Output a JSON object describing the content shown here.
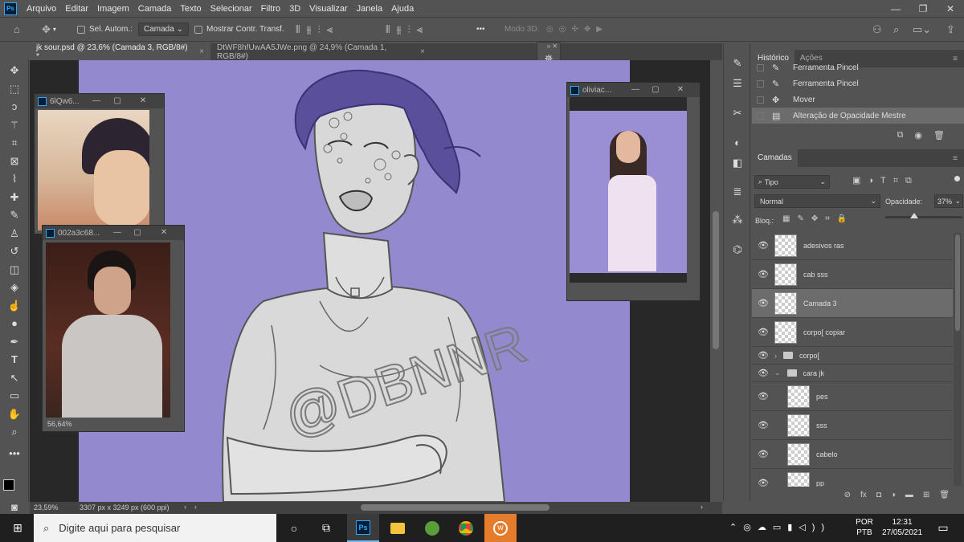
{
  "menu": {
    "logo": "Ps",
    "items": [
      "Arquivo",
      "Editar",
      "Imagem",
      "Camada",
      "Texto",
      "Selecionar",
      "Filtro",
      "3D",
      "Visualizar",
      "Janela",
      "Ajuda"
    ]
  },
  "options": {
    "auto_select_label": "Sel. Autom.:",
    "auto_select_target": "Camada",
    "show_transform_label": "Mostrar Contr. Transf.",
    "mode3d_label": "Modo 3D:",
    "more": "•••"
  },
  "tabs": [
    {
      "label": "jk sour.psd @ 23,6% (Camada 3, RGB/8#) *",
      "close": "×"
    },
    {
      "label": "DtWF8hfUwAA5JWe.png @ 24,9% (Camada 1, RGB/8#)",
      "close": "×"
    }
  ],
  "float_windows": {
    "win1": {
      "title": "6lQw6..."
    },
    "win2": {
      "title": "002a3c68...",
      "zoom": "56,64%"
    },
    "win3": {
      "title": "oliviac..."
    }
  },
  "artwork": {
    "watermark": "@DBNNR"
  },
  "status": {
    "zoom": "23,59%",
    "size": "3307 px x 3249 px (600 ppi)"
  },
  "history": {
    "tabs": [
      "Histórico",
      "Ações"
    ],
    "items": [
      {
        "label": "Ferramenta Pincel",
        "icon": "brush-icon"
      },
      {
        "label": "Ferramenta Pincel",
        "icon": "brush-icon"
      },
      {
        "label": "Mover",
        "icon": "move-icon"
      },
      {
        "label": "Alteração de Opacidade Mestre",
        "icon": "document-icon"
      }
    ]
  },
  "layers_panel": {
    "title": "Camadas",
    "filter": "Tipo",
    "blend_mode": "Normal",
    "opacity_label": "Opacidade:",
    "opacity_value": "37%",
    "opacity_fraction": 0.37,
    "lock_label": "Bloq.:",
    "layers": [
      {
        "name": "adesivos ras",
        "type": "layer",
        "indent": 0
      },
      {
        "name": "cab sss",
        "type": "layer",
        "indent": 0
      },
      {
        "name": "Camada 3",
        "type": "layer",
        "indent": 0,
        "selected": true
      },
      {
        "name": "corpo[ copiar",
        "type": "layer",
        "indent": 0
      },
      {
        "name": "corpo[",
        "type": "group",
        "indent": 0,
        "expanded": false
      },
      {
        "name": "cara jk",
        "type": "group",
        "indent": 0,
        "expanded": true
      },
      {
        "name": "pes",
        "type": "layer",
        "indent": 1
      },
      {
        "name": "sss",
        "type": "layer",
        "indent": 1
      },
      {
        "name": "cabelo",
        "type": "layer",
        "indent": 1
      },
      {
        "name": "pp",
        "type": "layer",
        "indent": 1
      }
    ]
  },
  "taskbar": {
    "search_placeholder": "Digite aqui para pesquisar",
    "lang": "POR",
    "lang_sub": "PTB",
    "time": "12:31",
    "date": "27/05/2021"
  },
  "colors": {
    "canvas_bg": "#9389cf",
    "ui_bg": "#535353",
    "ps_blue": "#31a8ff"
  }
}
